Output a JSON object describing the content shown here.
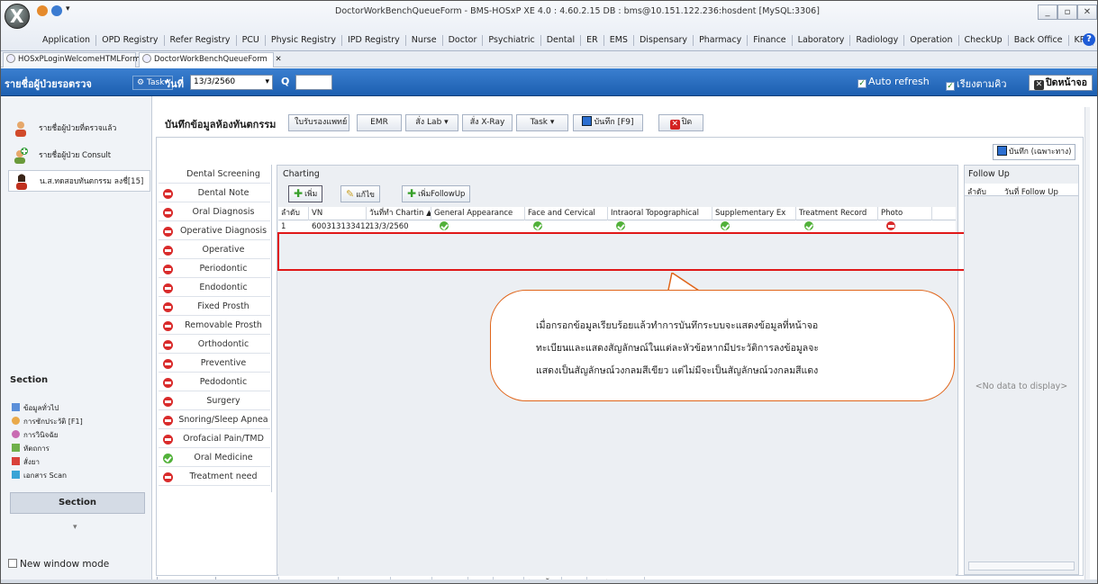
{
  "window": {
    "title": "DoctorWorkBenchQueueForm - BMS-HOSxP XE 4.0 : 4.60.2.15 DB : bms@10.151.122.236:hosdent [MySQL:3306]",
    "minimize": "_",
    "restore": "▫",
    "close": "✕"
  },
  "menubar": [
    "Application",
    "OPD Registry",
    "Refer Registry",
    "PCU",
    "Physic Registry",
    "IPD Registry",
    "Nurse",
    "Doctor",
    "Psychiatric",
    "Dental",
    "ER",
    "EMS",
    "Dispensary",
    "Pharmacy",
    "Finance",
    "Laboratory",
    "Radiology",
    "Operation",
    "CheckUp",
    "Back Office",
    "KPI",
    "GIS",
    "Tools"
  ],
  "doc_tabs": [
    {
      "label": "HOSxPLoginWelcomeHTMLForm"
    },
    {
      "label": "DoctorWorkBenchQueueForm",
      "close": "✕"
    }
  ],
  "header": {
    "title": "รายชื่อผู้ป่วยรอตรวจ",
    "task_label": "Task",
    "date_label": "วันที่",
    "date_value": "13/3/2560",
    "q_label": "Q",
    "auto_refresh": "Auto refresh",
    "sort_queue": "เรียงตามคิว",
    "close_screen": "ปิดหน้าจอ"
  },
  "left_panel": {
    "items": [
      {
        "label": "รายชื่อผู้ป่วยที่ตรวจแล้ว"
      },
      {
        "label": "รายชื่อผู้ป่วย Consult"
      },
      {
        "label": "น.ส.ทดสอบทันตกรรม ลงชื่[15]"
      }
    ],
    "section_title": "Section",
    "section_items": [
      "ข้อมูลทั่วไป",
      "การซักประวัติ [F1]",
      "การวินิจฉัย",
      "หัตถการ",
      "สั่งยา",
      "เอกสาร Scan"
    ],
    "section_button": "Section",
    "new_window_mode": "New window mode"
  },
  "toolbar": {
    "title": "บันทึกข้อมูลห้องทันตกรรม",
    "btn_cert": "ใบรับรองแพทย์",
    "btn_emr": "EMR",
    "btn_lab": "สั่ง Lab",
    "btn_xray": "สั่ง X-Ray",
    "btn_task": "Task",
    "btn_save": "บันทึก [F9]",
    "btn_close": "ปิด",
    "save_special": "บันทึก (เฉพาะทาง)"
  },
  "nav_list": [
    {
      "label": "Dental Screening",
      "status": "none"
    },
    {
      "label": "Dental Note",
      "status": "red"
    },
    {
      "label": "Oral Diagnosis",
      "status": "red"
    },
    {
      "label": "Operative Diagnosis",
      "status": "red"
    },
    {
      "label": "Operative",
      "status": "red"
    },
    {
      "label": "Periodontic",
      "status": "red"
    },
    {
      "label": "Endodontic",
      "status": "red"
    },
    {
      "label": "Fixed Prosth",
      "status": "red"
    },
    {
      "label": "Removable Prosth",
      "status": "red"
    },
    {
      "label": "Orthodontic",
      "status": "red"
    },
    {
      "label": "Preventive",
      "status": "red"
    },
    {
      "label": "Pedodontic",
      "status": "red"
    },
    {
      "label": "Surgery",
      "status": "red"
    },
    {
      "label": "Snoring/Sleep Apnea",
      "status": "red"
    },
    {
      "label": "Orofacial Pain/TMD",
      "status": "red"
    },
    {
      "label": "Oral Medicine",
      "status": "green"
    },
    {
      "label": "Treatment need",
      "status": "red"
    }
  ],
  "charting": {
    "title": "Charting",
    "btn_add": "เพิ่ม",
    "btn_edit": "แก้ไข",
    "btn_add_followup": "เพิ่มFollowUp",
    "columns": [
      "ลำดับ",
      "VN",
      "วันที่ทำ Chartin ▲",
      "General Appearance",
      "Face and Cervical",
      "Intraoral Topographical",
      "Supplementary Ex",
      "Treatment Record",
      "Photo"
    ],
    "rows": [
      {
        "no": "1",
        "vn": "600313133412",
        "date": "13/3/2560",
        "status": [
          "green",
          "green",
          "green",
          "green",
          "green",
          "red"
        ]
      }
    ]
  },
  "callout": {
    "lines": [
      "เมื่อกรอกข้อมูลเรียบร้อยแล้วทำการบันทึกระบบจะแสดงข้อมูลที่หน้าจอ",
      "ทะเบียนและแสดงสัญลักษณ์ในแต่ละหัวข้อหากมีประวัติการลงข้อมูลจะ",
      "แสดงเป็นสัญลักษณ์วงกลมสีเขียว แต่ไม่มีจะเป็นสัญลักษณ์วงกลมสีแดง"
    ]
  },
  "followup": {
    "title": "Follow Up",
    "col_no": "ลำดับ",
    "col_date": "วันที่ Follow Up",
    "no_data": "<No data to display>"
  },
  "bottom_tabs": [
    "การซักประวัติ",
    "ประวัติทันตกรรม",
    "การตรวจร่างกาย",
    "การนัดหมาย",
    "การส่งตัว",
    "Consult",
    "Note",
    "การแพ้ยา",
    "โรคเรื้อรัง",
    "ผ่าตัด",
    "การให้คำแนะนำ"
  ]
}
